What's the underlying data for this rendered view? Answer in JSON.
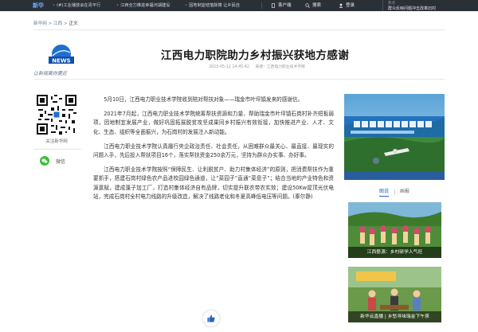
{
  "topbar": {
    "brand": "新华",
    "ticker": [
      "(#)工业播放会在青平行",
      "江西全力推进幸福河湖建设",
      "因地制宜结落脉搏 让乡民自"
    ],
    "client_label": "客户端",
    "search_label": "搜索",
    "login_label": "登录",
    "hot_title": "热点",
    "hot_text": "群众反映问题冲击改革旧村"
  },
  "breadcrumb": {
    "home": "新华网",
    "section": "江西",
    "current": "正文",
    "sep": ">"
  },
  "logo": {
    "slogan": "让新闻离你更近",
    "mark_text": "新华网"
  },
  "article": {
    "title": "江西电力职院助力乡村振兴获地方感谢",
    "date": "2023-05-12 14:45:42",
    "source": "来源：江西电力职业技术学院",
    "paragraphs": [
      "5月10日，江西电力职业技术学院收到陪对帮扶对象——瑞金市叶坪镇发来的感谢信。",
      "2021年7月起，江西电力职业技术学院统筹帮扶资源和力量，帮助瑞金市叶坪镇石岗村补齐短板弱项，因地制宜发展产业，做好巩固拓展脱贫攻坚成果同乡村振兴有效衔接，加快推进产业、人才、文化、生态、组织等全面振兴，为石岗村的发展注入新动能。",
      "江西电力职业技术学院认真履行央企政治责任、社会责任，从困难群众最关心、最直接、最现实的问题入手，先后投入帮扶项目16个，落实帮扶资金250余万元，坚持为群众办实事、办好事。",
      "江西电力职业技术学院按照“保障民生、让利脱贫户、助力村集体经济”的原则，把消费帮扶作为重要抓手，搭建石岗村绿色农产品进校园绿色通道，让“菜园子”直通“菜盘子”；结合当地的产业特色和资源禀赋，建成蓬子加工厂，打造村集体经济自有品牌，切实提升联农带农实效；建设50Kw屋顶光伏电站，完成石岗村全村电力线路的升级改造，解决了线路老化和冬夏高峰低电压等问题。(秦尔静)"
    ]
  },
  "sidebar_left": {
    "qr_label": "关注新华网",
    "wechat_label": "微信"
  },
  "right": {
    "tabs": [
      "图说",
      "画报"
    ],
    "photos": [
      {
        "caption": "江西婺源：乡村研学人气旺"
      },
      {
        "caption": "新华云直播 | 乡愁寻味瑞金下午茶"
      }
    ]
  },
  "colors": {
    "topbar": "#2b3037",
    "link": "#2862c2",
    "wechat": "#3ebd3c"
  },
  "icons": [
    "phone-icon",
    "search-icon",
    "user-icon",
    "thumbs-up-icon",
    "wechat-icon",
    "qr-code"
  ]
}
